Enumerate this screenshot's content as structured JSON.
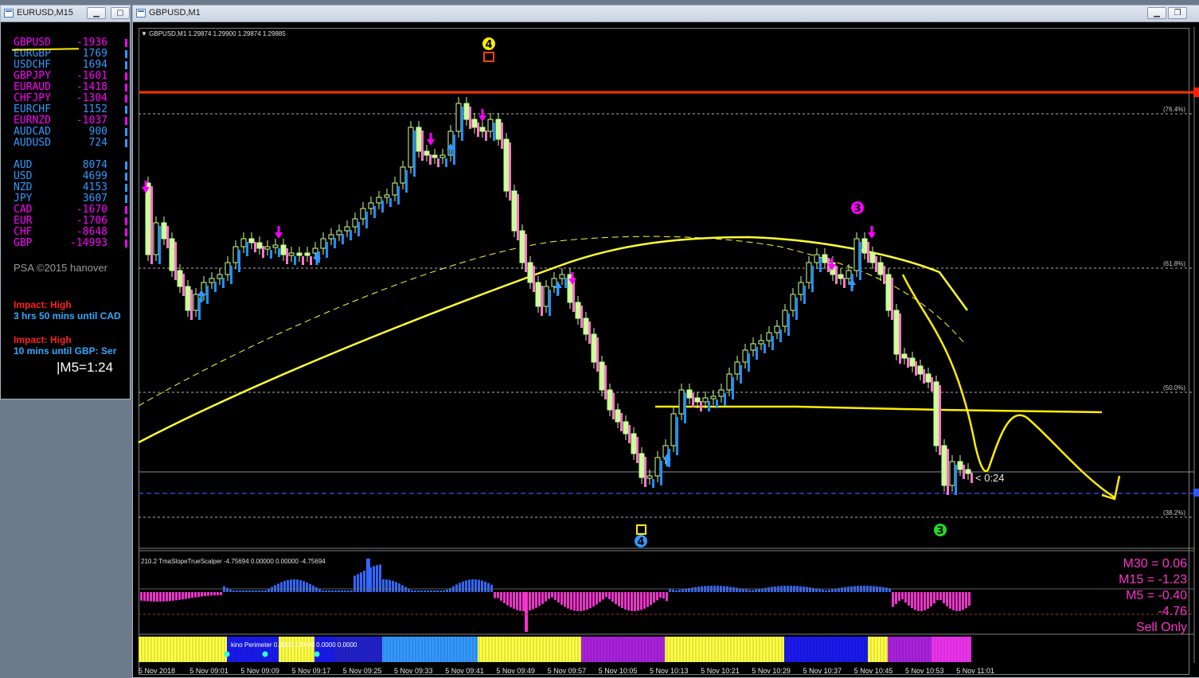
{
  "left_window": {
    "title": "EURUSD,M15",
    "pairs": [
      {
        "name": "GBPUSD",
        "value": "-1936",
        "color": "#ff00ff"
      },
      {
        "name": "EURGBP",
        "value": "1769",
        "color": "#3399ff"
      },
      {
        "name": "USDCHF",
        "value": "1694",
        "color": "#3399ff"
      },
      {
        "name": "GBPJPY",
        "value": "-1601",
        "color": "#ff00ff"
      },
      {
        "name": "EURAUD",
        "value": "-1418",
        "color": "#ff00ff"
      },
      {
        "name": "CHFJPY",
        "value": "-1304",
        "color": "#ff00ff"
      },
      {
        "name": "EURCHF",
        "value": "1152",
        "color": "#3399ff"
      },
      {
        "name": "EURNZD",
        "value": "-1037",
        "color": "#ff00ff"
      },
      {
        "name": "AUDCAD",
        "value": "900",
        "color": "#3399ff"
      },
      {
        "name": "AUDUSD",
        "value": "724",
        "color": "#3399ff"
      }
    ],
    "currencies": [
      {
        "name": "AUD",
        "value": "8074",
        "color": "#3399ff"
      },
      {
        "name": "USD",
        "value": "4699",
        "color": "#3399ff"
      },
      {
        "name": "NZD",
        "value": "4153",
        "color": "#3399ff"
      },
      {
        "name": "JPY",
        "value": "3607",
        "color": "#3399ff"
      },
      {
        "name": "CAD",
        "value": "-1670",
        "color": "#ff00ff"
      },
      {
        "name": "EUR",
        "value": "-1706",
        "color": "#ff00ff"
      },
      {
        "name": "CHF",
        "value": "-8648",
        "color": "#ff00ff"
      },
      {
        "name": "GBP",
        "value": "-14993",
        "color": "#ff00ff"
      }
    ],
    "credit": "PSA ©2015 hanover",
    "news": [
      {
        "impact": "Impact: High",
        "until": "3 hrs 50 mins until CAD"
      },
      {
        "impact": "Impact: High",
        "until": "10 mins until GBP: Ser"
      }
    ],
    "timer": "|M5=1:24"
  },
  "chart_window": {
    "title": "GBPUSD,M1",
    "header": "GBPUSD,M1  1.29874 1.29900 1.29874 1.29885",
    "fib_levels": [
      "(76.4%)",
      "(61.8%)",
      "(50.0%)",
      "(38.2%)"
    ],
    "wave_labels": {
      "top": "4",
      "bottom": "4",
      "right_top": "3",
      "right_bottom": "3"
    },
    "countdown": "< 0:24",
    "indicator_header": "210.2 TmaSlopeTrueScalper -4.75694 0.00000 0.00000 -4.75694",
    "slopes": {
      "m30": "M30 = 0.06",
      "m15": "M15 = -1.23",
      "m5": "M5 = -0.40",
      "cur": "-4.76",
      "signal": "Sell Only"
    },
    "bar_indicator_header": "kino Perimeter 0.0000 1.0000 0.0000 0.0000",
    "time_labels": [
      "5 Nov 2018",
      "5 Nov 09:01",
      "5 Nov 09:09",
      "5 Nov 09:17",
      "5 Nov 09:25",
      "5 Nov 09:33",
      "5 Nov 09:41",
      "5 Nov 09:49",
      "5 Nov 09:57",
      "5 Nov 10:05",
      "5 Nov 10:13",
      "5 Nov 10:21",
      "5 Nov 10:29",
      "5 Nov 10:37",
      "5 Nov 10:45",
      "5 Nov 10:53",
      "5 Nov 11:01"
    ],
    "colors": {
      "bull": "#ccff99",
      "bear_hist": "#ff66cc",
      "up_arrow": "#3399ff",
      "down_arrow": "#ff00ff",
      "ma": "#ffff33",
      "resistance": "#ff3300"
    }
  }
}
